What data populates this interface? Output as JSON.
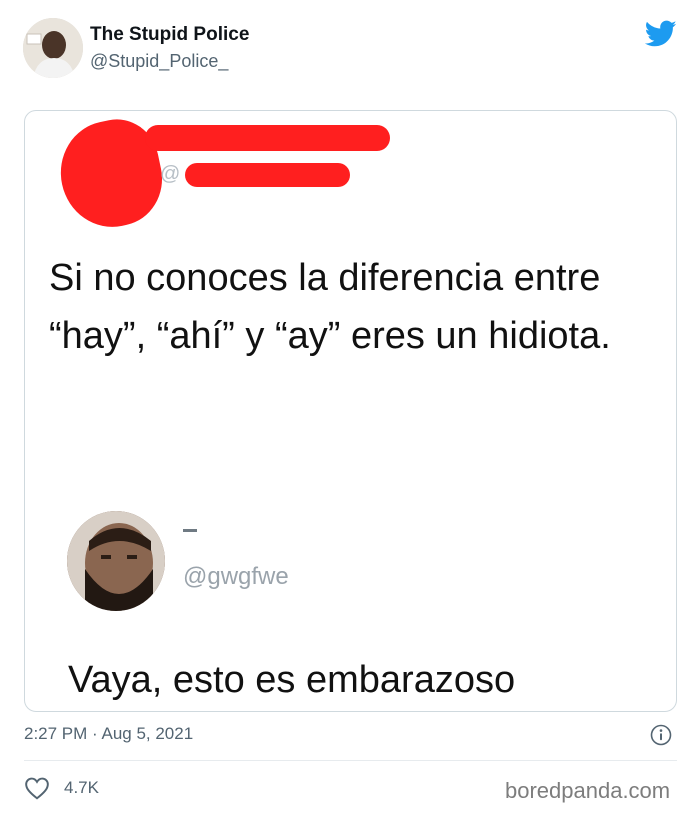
{
  "author": {
    "name": "The Stupid Police",
    "handle": "@Stupid_Police_"
  },
  "quoted_tweet": {
    "at_sign": "@",
    "text": "Si no conoces la diferencia entre “hay”, “ahí” y “ay” eres un hidiota.",
    "reply_handle": "@gwgfwe",
    "reply_text": "Vaya, esto es embarazoso"
  },
  "footer": {
    "timestamp": "2:27 PM · Aug 5, 2021",
    "like_count": "4.7K"
  },
  "watermark": "boredpanda.com",
  "colors": {
    "twitter_blue": "#1d9bf0",
    "redaction_red": "#ff1f1f",
    "muted_text": "#536471"
  },
  "icons": {
    "logo": "twitter-bird-icon",
    "info": "info-icon",
    "like": "heart-icon"
  }
}
